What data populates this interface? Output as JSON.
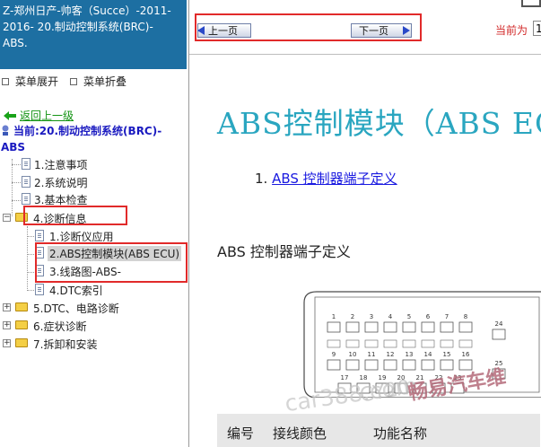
{
  "sidebar": {
    "header_lines": [
      "Z-郑州日产-帅客（Succe）-2011-",
      "2016- 20.制动控制系统(BRC)-",
      "ABS."
    ],
    "expand_label": "菜单展开",
    "collapse_label": "菜单折叠",
    "back_label": "返回上一级",
    "current_line1": "当前:20.制动控制系统(BRC)-",
    "current_line2": "ABS",
    "items": [
      {
        "label": "1.注意事项"
      },
      {
        "label": "2.系统说明"
      },
      {
        "label": "3.基本检查"
      },
      {
        "label": "4.诊断信息"
      },
      {
        "label": "1.诊断仪应用"
      },
      {
        "label": "2.ABS控制模块(ABS ECU)"
      },
      {
        "label": "3.线路图-ABS-"
      },
      {
        "label": "4.DTC索引"
      },
      {
        "label": "5.DTC、电路诊断"
      },
      {
        "label": "6.症状诊断"
      },
      {
        "label": "7.拆卸和安装"
      }
    ]
  },
  "toolbar": {
    "prev_label": "上一页",
    "next_label": "下一页",
    "page_label": "当前为",
    "page_value": "1"
  },
  "content": {
    "title": "ABS控制模块（ABS EC",
    "toc_number": "1.",
    "toc_link": "ABS 控制器端子定义",
    "section_title": "ABS  控制器端子定义",
    "connector_pins": [
      "1",
      "2",
      "3",
      "4",
      "5",
      "6",
      "7",
      "8",
      "9",
      "10",
      "11",
      "12",
      "13",
      "14",
      "15",
      "16",
      "17",
      "18",
      "19",
      "20",
      "21",
      "22",
      "23",
      "24",
      "25"
    ],
    "table_headers": [
      "编号",
      "接线颜色",
      "功能名称"
    ]
  },
  "watermarks": [
    "car388.com",
    "畅易汽车维",
    "CY20"
  ],
  "colors": {
    "header_bg": "#1d6fa2",
    "title_color": "#2aa6c0",
    "highlight_red": "#e12a2a",
    "link_blue": "#1a1ae0"
  }
}
